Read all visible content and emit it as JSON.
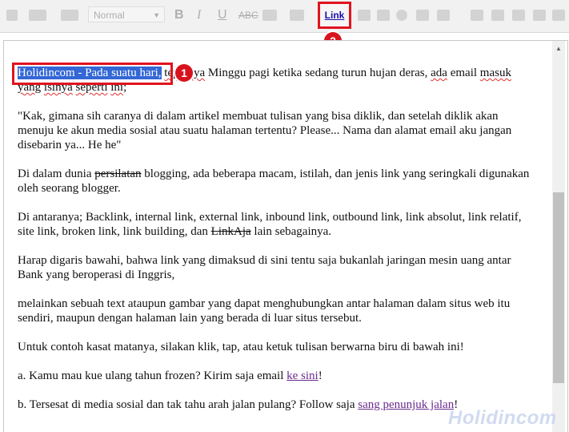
{
  "toolbar": {
    "font_select_value": "Normal",
    "link_label": "Link",
    "icons": [
      "font-family-icon",
      "font-size-icon",
      "bold-icon",
      "italic-icon",
      "underline-icon",
      "strikethrough-icon",
      "text-color-icon",
      "link-icon",
      "image-icon",
      "video-icon",
      "emoji-icon",
      "align-icon",
      "numbered-list-icon",
      "bulleted-list-icon",
      "quote-icon",
      "clear-format-icon",
      "spellcheck-icon"
    ]
  },
  "badges": {
    "one": "1",
    "two": "2"
  },
  "editor": {
    "p1": {
      "selected": "Holidincom - Pada suatu hari,",
      "pre": " ",
      "w1": "tepatnya",
      "mid1": " Minggu pagi ketika sedang turun hujan deras, ",
      "w2": "ada",
      "mid2": " email ",
      "w3": "masuk",
      "mid3": " ",
      "w4": "yang",
      "mid4": " ",
      "w5": "isinya",
      "mid5": " ",
      "w6": "seperti",
      "mid6": " ",
      "w7": "ini",
      "end": ";"
    },
    "p2": "\"Kak, gimana sih caranya di dalam artikel membuat tulisan yang bisa diklik, dan setelah diklik akan menuju ke akun media sosial atau suatu halaman tertentu? Please... Nama dan alamat email aku jangan disebarin ya... He he\"",
    "p3a": "Di dalam dunia ",
    "p3s": "persilatan",
    "p3b": " blogging, ada beberapa macam, istilah, dan jenis link yang seringkali digunakan oleh seorang blogger.",
    "p4a": "Di antaranya; Backlink, internal link, external link, inbound link, outbound link, link absolut, link relatif, site link, broken link, link building, dan ",
    "p4s": "LinkAja",
    "p4b": " lain sebagainya.",
    "p5": "Harap digaris bawahi, bahwa link yang dimaksud di sini tentu saja bukanlah jaringan mesin uang antar Bank yang beroperasi di Inggris,",
    "p6": "melainkan sebuah text ataupun gambar yang dapat menghubungkan antar halaman dalam situs web itu sendiri, maupun dengan halaman lain yang berada di luar situs tersebut.",
    "p7": "Untuk contoh kasat matanya, silakan klik, tap, atau ketuk tulisan berwarna biru di bawah ini!",
    "p8a": "a. Kamu mau kue ulang tahun frozen? Kirim saja email ",
    "p8link": "ke sini",
    "p8b": "!",
    "p9a": "b. Tersesat di media sosial dan tak tahu arah jalan pulang? Follow saja ",
    "p9link": "sang penunjuk jalan",
    "p9b": "!"
  },
  "watermark": "Holidincom"
}
